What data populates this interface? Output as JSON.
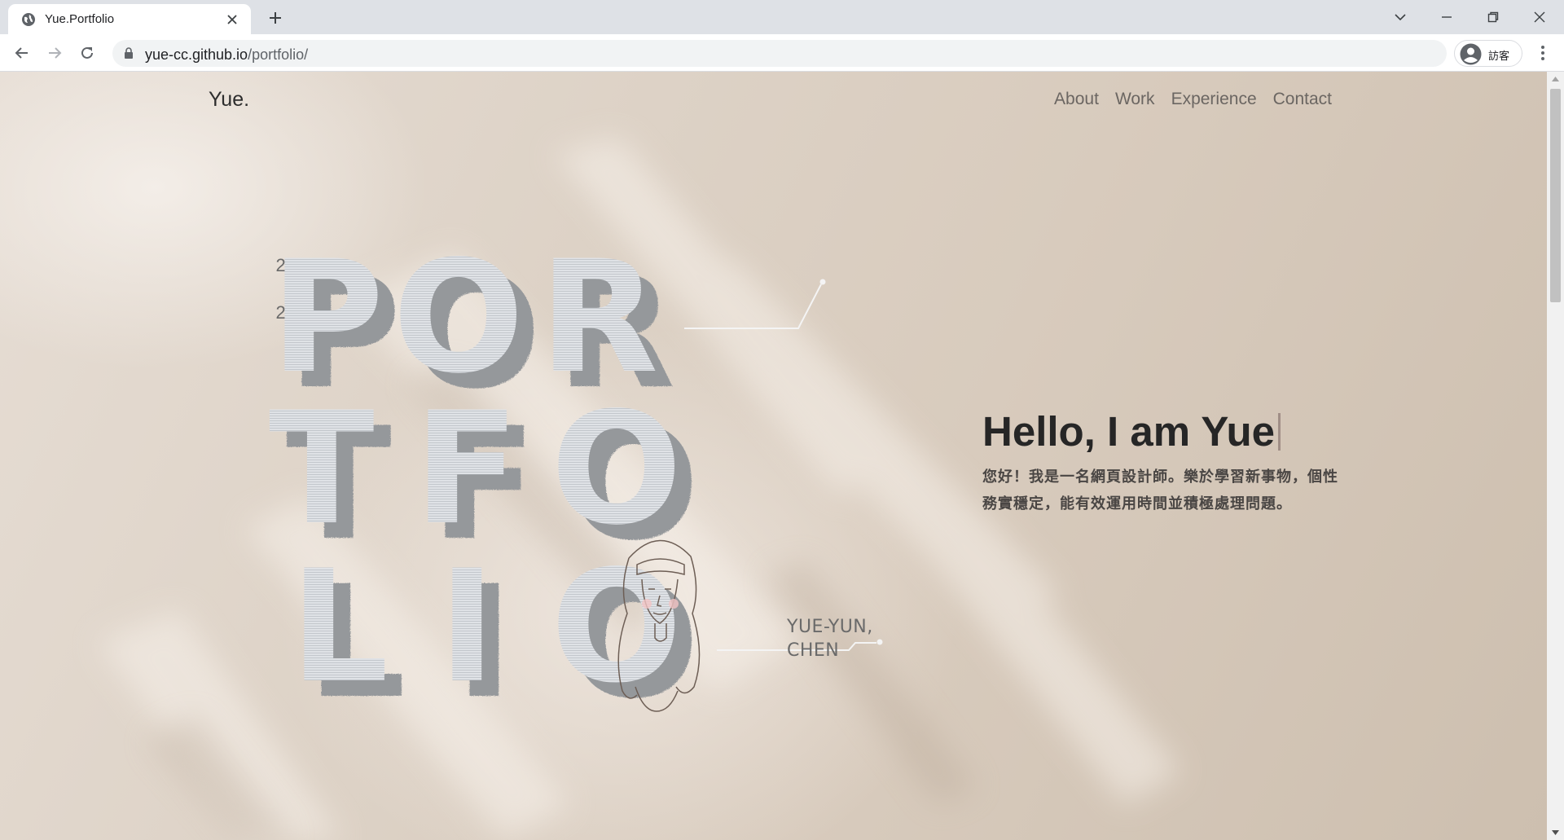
{
  "browser": {
    "tab_title": "Yue.Portfolio",
    "url_host": "yue-cc.github.io",
    "url_path": "/portfolio/",
    "profile_label": "訪客"
  },
  "site": {
    "logo": "Yue.",
    "nav": [
      {
        "label": "About"
      },
      {
        "label": "Work"
      },
      {
        "label": "Experience"
      },
      {
        "label": "Contact"
      }
    ],
    "hero": {
      "year_start": "2016",
      "year_end": "2022",
      "art_letters": [
        "P",
        "O",
        "R",
        "T",
        "F",
        "O",
        "L",
        "I",
        "O"
      ],
      "name_line1": "YUE-YUN,",
      "name_line2": "CHEN",
      "title": "Hello, I am Yue",
      "intro": "您好！我是一名網頁設計師。樂於學習新事物，個性務實穩定，能有效運用時間並積極處理問題。"
    }
  },
  "colors": {
    "background": "#ddd2c6",
    "letter_face": "#d4d7dc",
    "letter_shadow": "#9a9c9e",
    "text_dark": "#262626",
    "nav_text": "#6b6662"
  }
}
